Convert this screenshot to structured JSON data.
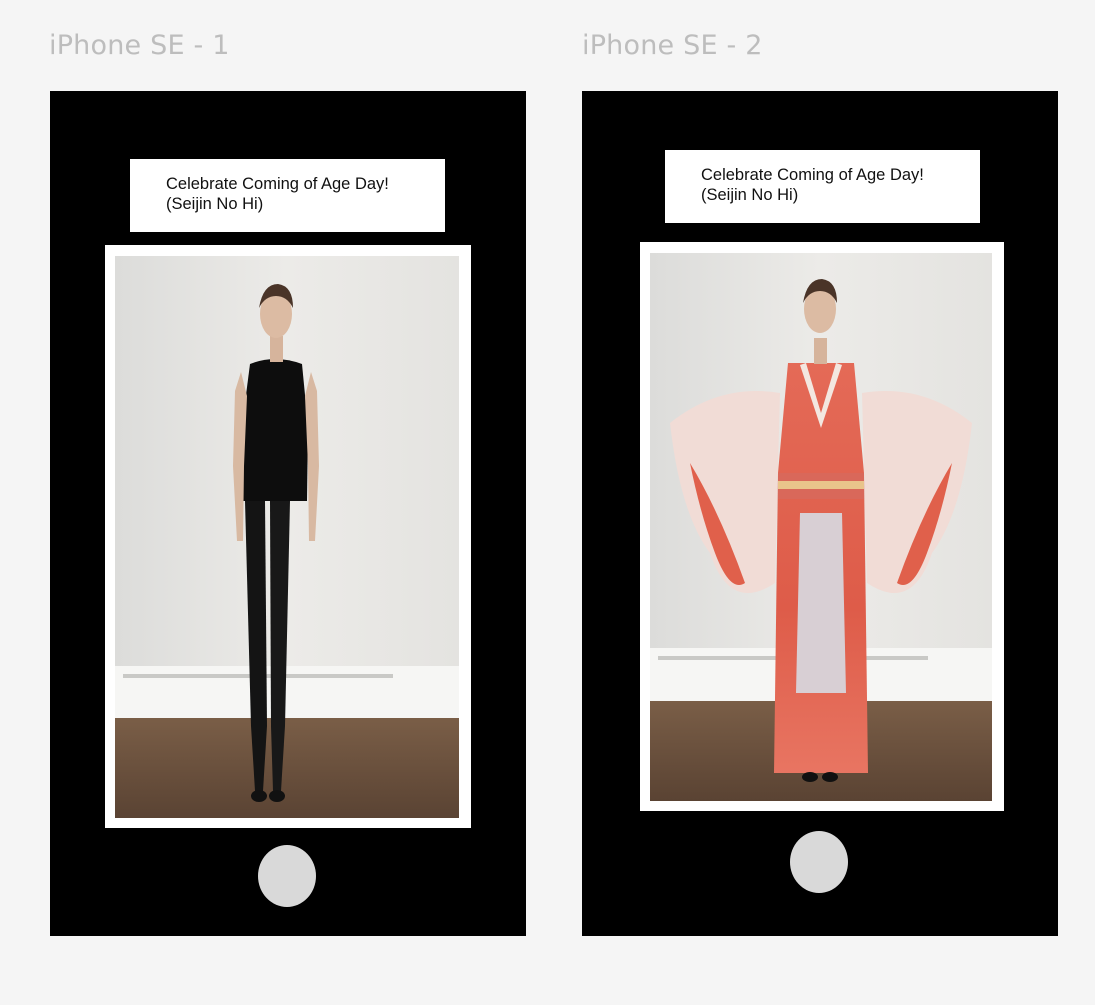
{
  "frames": [
    {
      "title": "iPhone SE - 1",
      "banner_line1": "Celebrate Coming of Age Day!",
      "banner_line2": "(Seijin No Hi)",
      "outfit": "black sleeveless top and black leather leggings"
    },
    {
      "title": "iPhone SE - 2",
      "banner_line1": "Celebrate Coming of Age Day!",
      "banner_line2": "(Seijin No Hi)",
      "outfit": "red floral furisode kimono"
    }
  ],
  "colors": {
    "canvas": "#f5f5f5",
    "phone_body": "#000000",
    "home_button": "#d9d9d9",
    "frame_label": "#bdbdbd",
    "kimono": "#e2604e"
  }
}
